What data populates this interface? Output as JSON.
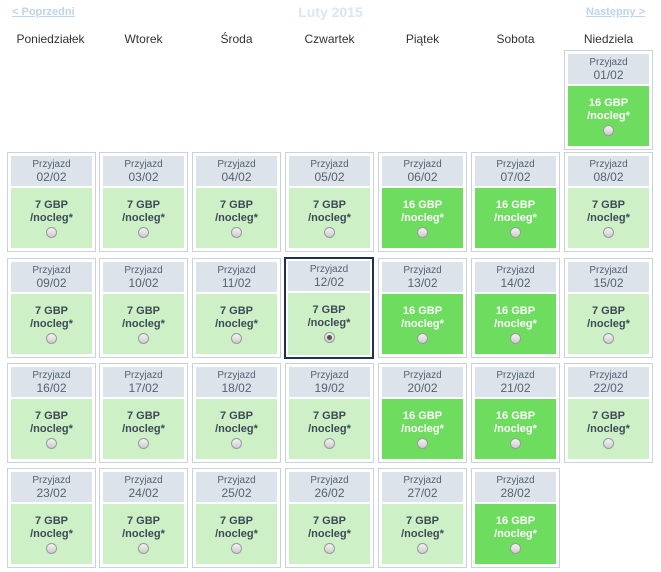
{
  "header": {
    "prev_label": "< Poprzedni",
    "month_title": "Luty 2015",
    "next_label": "Następny >"
  },
  "weekdays": [
    "Poniedziałek",
    "Wtorek",
    "Środa",
    "Czwartek",
    "Piątek",
    "Sobota",
    "Niedziela"
  ],
  "cell_label": "Przyjazd",
  "night_label": "/nocleg*",
  "colors": {
    "standard_rate_bg": "#cdf0c6",
    "high_rate_bg": "#6edc5e",
    "selected_border": "#1f3350"
  },
  "days": [
    {
      "date": "01/02",
      "price": "16 GBP",
      "high": true
    },
    {
      "date": "02/02",
      "price": "7 GBP"
    },
    {
      "date": "03/02",
      "price": "7 GBP"
    },
    {
      "date": "04/02",
      "price": "7 GBP"
    },
    {
      "date": "05/02",
      "price": "7 GBP"
    },
    {
      "date": "06/02",
      "price": "16 GBP",
      "high": true
    },
    {
      "date": "07/02",
      "price": "16 GBP",
      "high": true
    },
    {
      "date": "08/02",
      "price": "7 GBP"
    },
    {
      "date": "09/02",
      "price": "7 GBP"
    },
    {
      "date": "10/02",
      "price": "7 GBP"
    },
    {
      "date": "11/02",
      "price": "7 GBP"
    },
    {
      "date": "12/02",
      "price": "7 GBP",
      "selected": true
    },
    {
      "date": "13/02",
      "price": "16 GBP",
      "high": true
    },
    {
      "date": "14/02",
      "price": "16 GBP",
      "high": true
    },
    {
      "date": "15/02",
      "price": "7 GBP"
    },
    {
      "date": "16/02",
      "price": "7 GBP"
    },
    {
      "date": "17/02",
      "price": "7 GBP"
    },
    {
      "date": "18/02",
      "price": "7 GBP"
    },
    {
      "date": "19/02",
      "price": "7 GBP"
    },
    {
      "date": "20/02",
      "price": "16 GBP",
      "high": true
    },
    {
      "date": "21/02",
      "price": "16 GBP",
      "high": true
    },
    {
      "date": "22/02",
      "price": "7 GBP"
    },
    {
      "date": "23/02",
      "price": "7 GBP"
    },
    {
      "date": "24/02",
      "price": "7 GBP"
    },
    {
      "date": "25/02",
      "price": "7 GBP"
    },
    {
      "date": "26/02",
      "price": "7 GBP"
    },
    {
      "date": "27/02",
      "price": "7 GBP"
    },
    {
      "date": "28/02",
      "price": "16 GBP",
      "high": true
    }
  ]
}
